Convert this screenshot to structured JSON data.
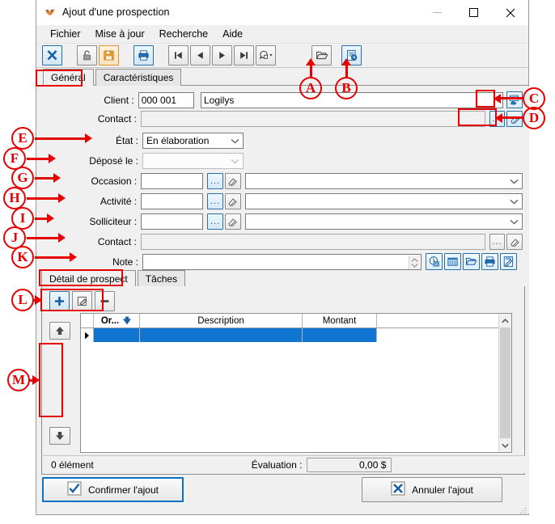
{
  "window": {
    "title": "Ajout d'une prospection",
    "icon": "app-logo-icon",
    "minimize_label": "",
    "maximize_label": "",
    "close_label": ""
  },
  "menubar": {
    "items": [
      {
        "label": "Fichier",
        "name": "menu-fichier"
      },
      {
        "label": "Mise à jour",
        "name": "menu-mise-a-jour"
      },
      {
        "label": "Recherche",
        "name": "menu-recherche"
      },
      {
        "label": "Aide",
        "name": "menu-aide"
      }
    ]
  },
  "toolbar": {
    "buttons": [
      {
        "name": "close-record-button",
        "icon": "x-icon"
      },
      {
        "name": "lock-button",
        "icon": "padlock-icon"
      },
      {
        "name": "save-button",
        "icon": "floppy-disk-icon"
      },
      {
        "name": "print-button",
        "icon": "printer-icon"
      },
      {
        "name": "first-record-button",
        "icon": "first-record-icon"
      },
      {
        "name": "previous-record-button",
        "icon": "previous-record-icon"
      },
      {
        "name": "next-record-button",
        "icon": "next-record-icon"
      },
      {
        "name": "last-record-button",
        "icon": "last-record-icon"
      },
      {
        "name": "search-dropdown-button",
        "icon": "magnifier-dropdown-icon"
      },
      {
        "name": "open-folder-button",
        "icon": "open-folder-icon"
      },
      {
        "name": "report-button",
        "icon": "document-clock-icon"
      }
    ]
  },
  "tabs": {
    "items": [
      {
        "label": "Général",
        "name": "tab-general",
        "active": true
      },
      {
        "label": "Caractéristiques",
        "name": "tab-caracteristiques",
        "active": false
      }
    ]
  },
  "form": {
    "client": {
      "label": "Client :",
      "code_value": "000 001",
      "name_value": "Logilys",
      "lookup_icon": "hand-card-icon"
    },
    "contact_top": {
      "label": "Contact :",
      "value": "",
      "browse_label": "...",
      "clear_icon": "eraser-icon"
    },
    "etat": {
      "label": "État :",
      "value": "En élaboration",
      "options": [
        "En élaboration"
      ]
    },
    "depose_le": {
      "label": "Déposé le :",
      "value": ""
    },
    "occasion": {
      "label": "Occasion :",
      "code_value": "",
      "desc_value": "",
      "browse_label": "...",
      "clear_icon": "eraser-icon"
    },
    "activite": {
      "label": "Activité :",
      "code_value": "",
      "desc_value": "",
      "browse_label": "...",
      "clear_icon": "eraser-icon"
    },
    "solliciteur": {
      "label": "Solliciteur :",
      "code_value": "",
      "desc_value": "",
      "browse_label": "...",
      "clear_icon": "eraser-icon"
    },
    "contact": {
      "label": "Contact :",
      "value": "",
      "browse_label": "...",
      "clear_icon": "eraser-icon"
    },
    "note": {
      "label": "Note :",
      "value": "",
      "tools": [
        {
          "name": "schedule-button",
          "icon": "clock-calendar-icon"
        },
        {
          "name": "calendar-button",
          "icon": "calendar-icon"
        },
        {
          "name": "open-file-button",
          "icon": "open-folder-blue-icon"
        },
        {
          "name": "print-note-button",
          "icon": "printer-blue-icon"
        },
        {
          "name": "edit-note-button",
          "icon": "note-edit-icon"
        }
      ]
    }
  },
  "detail": {
    "tabs": [
      {
        "label": "Détail de prospect",
        "name": "tab-detail-de-prospect",
        "active": true
      },
      {
        "label": "Tâches",
        "name": "tab-taches",
        "active": false
      }
    ],
    "toolbar": [
      {
        "name": "add-line-button",
        "icon": "plus-icon"
      },
      {
        "name": "edit-line-button",
        "icon": "edit-pencil-icon"
      },
      {
        "name": "delete-line-button",
        "icon": "minus-icon"
      }
    ],
    "move_buttons": [
      {
        "name": "move-up-button",
        "icon": "arrow-up-icon"
      },
      {
        "name": "move-down-button",
        "icon": "arrow-down-icon"
      }
    ],
    "grid": {
      "columns": [
        "Or...",
        "Description",
        "Montant"
      ],
      "sorted_column": "Or...",
      "sort_direction": "descending",
      "rows": [
        {
          "selected": true,
          "order": "",
          "description": "",
          "montant": ""
        }
      ]
    },
    "status": {
      "count_label": "0 élément",
      "evaluation_label": "Évaluation :",
      "evaluation_value": "0,00 $"
    }
  },
  "footer": {
    "confirm_label": "Confirmer l'ajout",
    "confirm_icon": "checkmark-icon",
    "cancel_label": "Annuler l'ajout",
    "cancel_icon": "x-blue-icon"
  },
  "annotations": {
    "a": "A",
    "b": "B",
    "c": "C",
    "d": "D",
    "e": "E",
    "f": "F",
    "g": "G",
    "h": "H",
    "i": "I",
    "j": "J",
    "k": "K",
    "l": "L",
    "m": "M"
  },
  "colors": {
    "annotation_red": "#e60000",
    "selection_blue": "#0f75d0",
    "accent_blue": "#0d72c4",
    "window_bg": "#f0f0f0"
  }
}
